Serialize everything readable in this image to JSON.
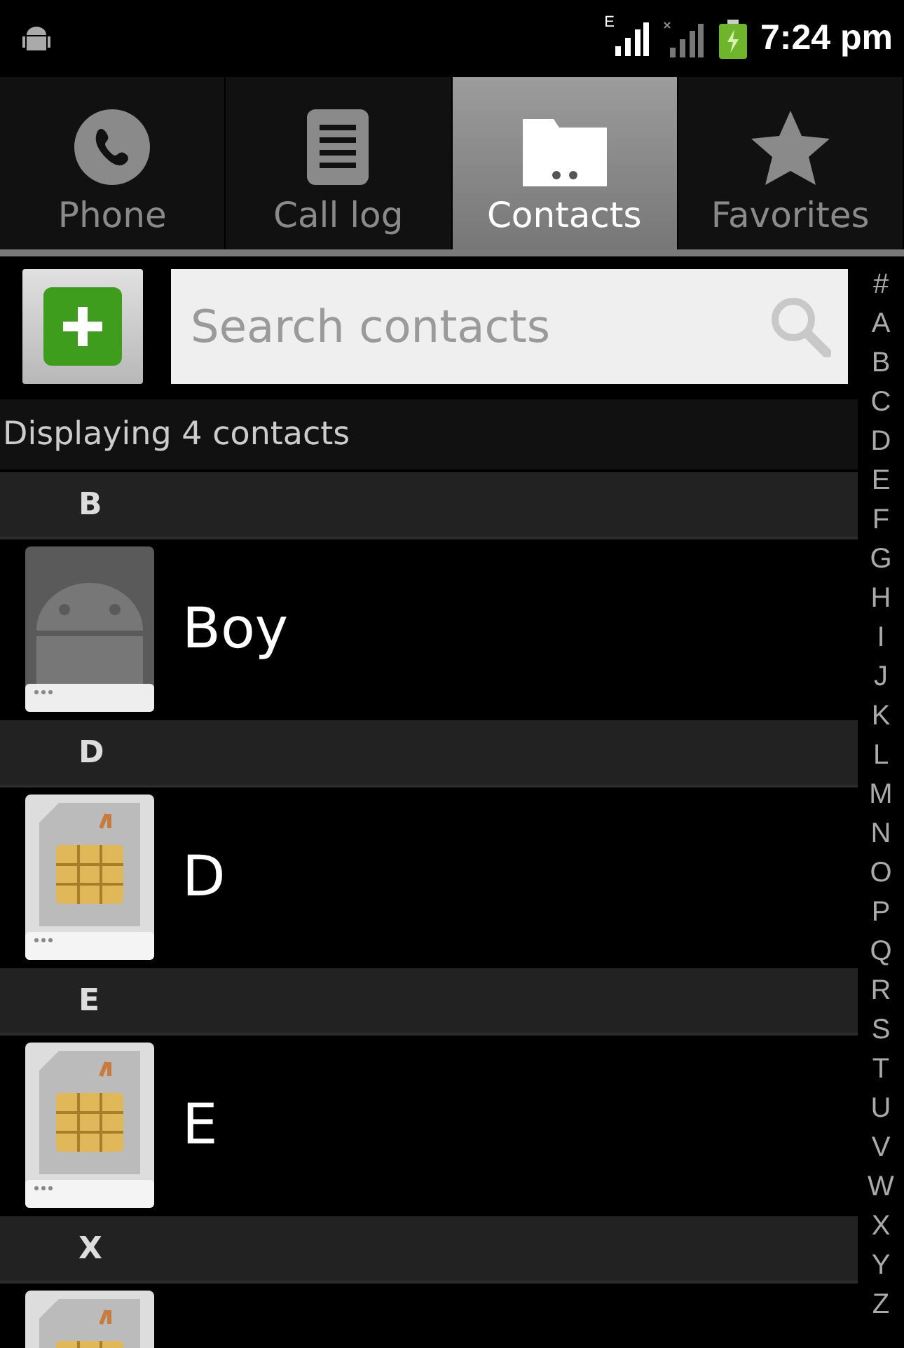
{
  "status_bar": {
    "network_type": "E",
    "time": "7:24 pm"
  },
  "tabs": [
    {
      "label": "Phone",
      "kind": "phone",
      "selected": false
    },
    {
      "label": "Call log",
      "kind": "log",
      "selected": false
    },
    {
      "label": "Contacts",
      "kind": "contacts",
      "selected": true
    },
    {
      "label": "Favorites",
      "kind": "favorites",
      "selected": false
    }
  ],
  "search": {
    "placeholder": "Search contacts"
  },
  "count_label": "Displaying 4 contacts",
  "sections": [
    {
      "letter": "B",
      "contacts": [
        {
          "name": "Boy",
          "kind": "android"
        }
      ]
    },
    {
      "letter": "D",
      "contacts": [
        {
          "name": "D",
          "kind": "sim"
        }
      ]
    },
    {
      "letter": "E",
      "contacts": [
        {
          "name": "E",
          "kind": "sim"
        }
      ]
    },
    {
      "letter": "X",
      "contacts": [
        {
          "kind": "sim"
        }
      ]
    }
  ],
  "index_letters": [
    "#",
    "A",
    "B",
    "C",
    "D",
    "E",
    "F",
    "G",
    "H",
    "I",
    "J",
    "K",
    "L",
    "M",
    "N",
    "O",
    "P",
    "Q",
    "R",
    "S",
    "T",
    "U",
    "V",
    "W",
    "X",
    "Y",
    "Z"
  ]
}
